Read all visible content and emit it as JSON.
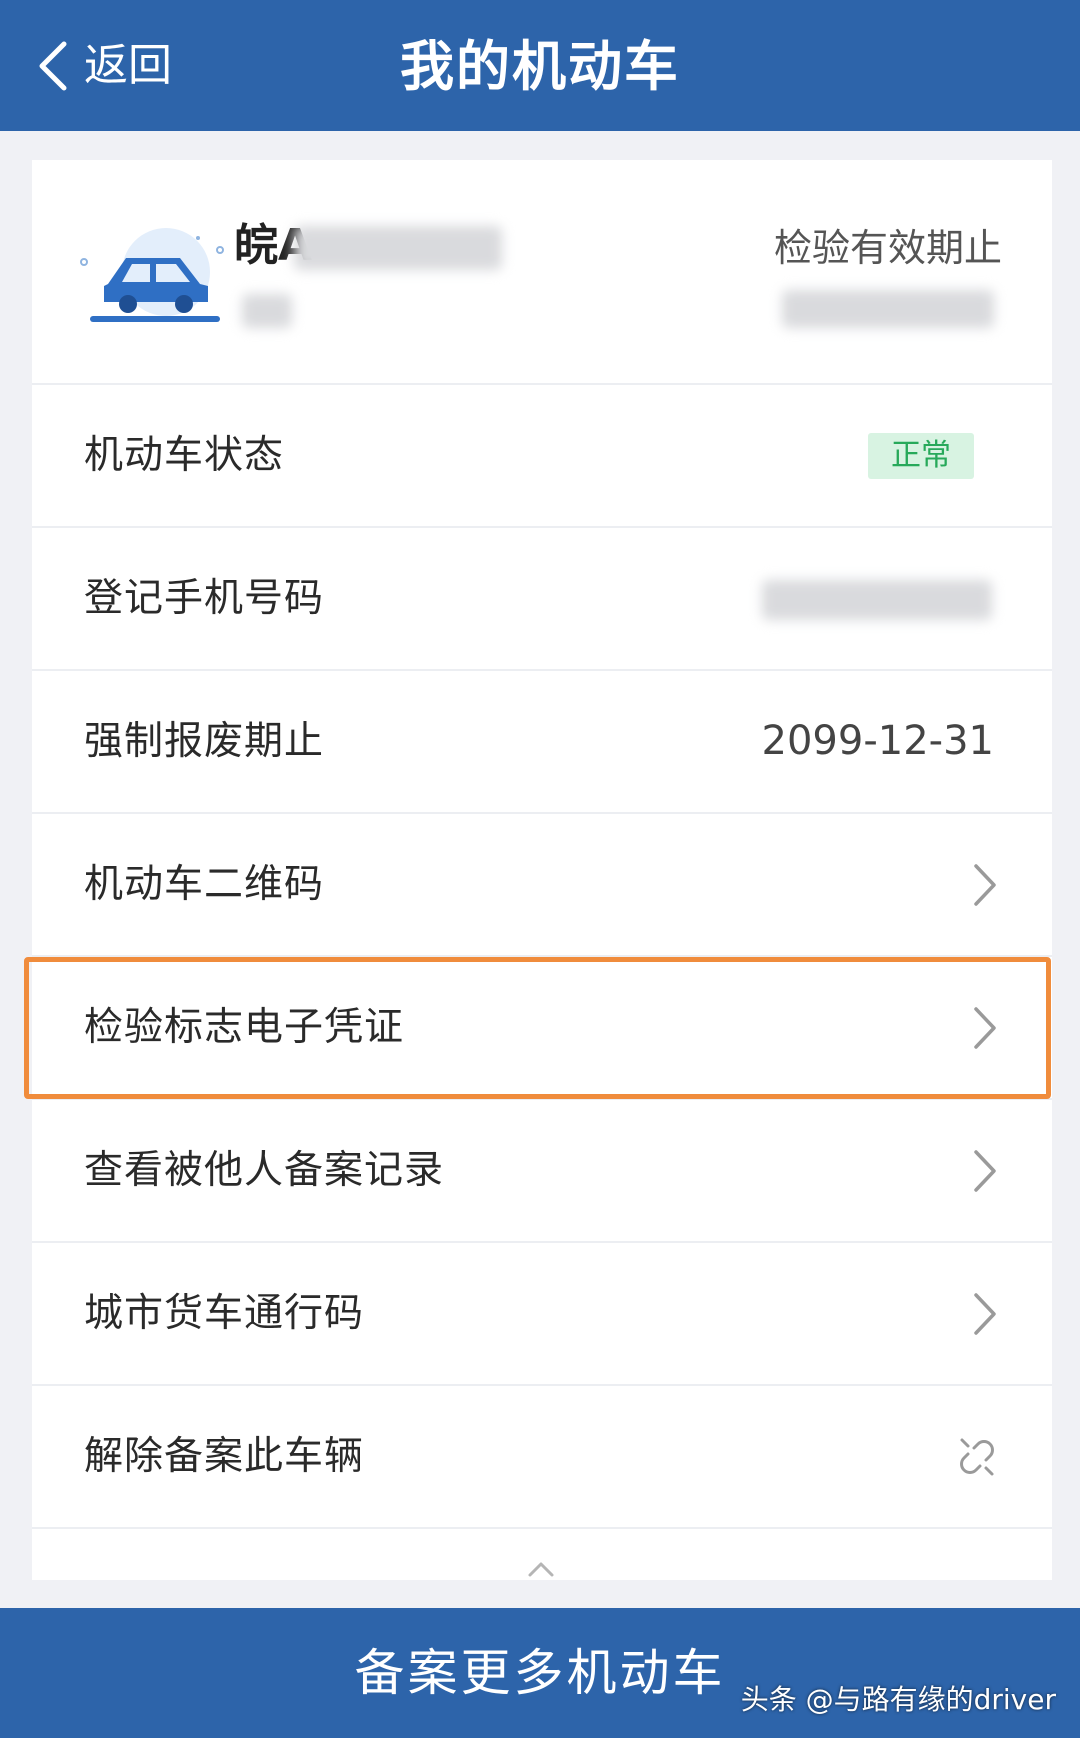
{
  "header": {
    "back_label": "返回",
    "title": "我的机动车"
  },
  "vehicle": {
    "plate_prefix": "皖A",
    "inspection_label": "检验有效期止"
  },
  "rows": [
    {
      "label": "机动车状态",
      "status_badge": "正常"
    },
    {
      "label": "登记手机号码"
    },
    {
      "label": "强制报废期止",
      "value": "2099-12-31"
    },
    {
      "label": "机动车二维码"
    },
    {
      "label": "检验标志电子凭证"
    },
    {
      "label": "查看被他人备案记录"
    },
    {
      "label": "城市货车通行码"
    },
    {
      "label": "解除备案此车辆"
    }
  ],
  "footer": {
    "button_label": "备案更多机动车",
    "watermark": "头条 @与路有缘的driver"
  },
  "colors": {
    "brand_blue": "#2d64aa",
    "highlight_orange": "#f08c3c",
    "status_green": "#27a95a"
  },
  "icons": [
    "chevron-left-icon",
    "car-icon",
    "chevron-right-icon",
    "unlink-icon",
    "chevron-up-icon"
  ]
}
